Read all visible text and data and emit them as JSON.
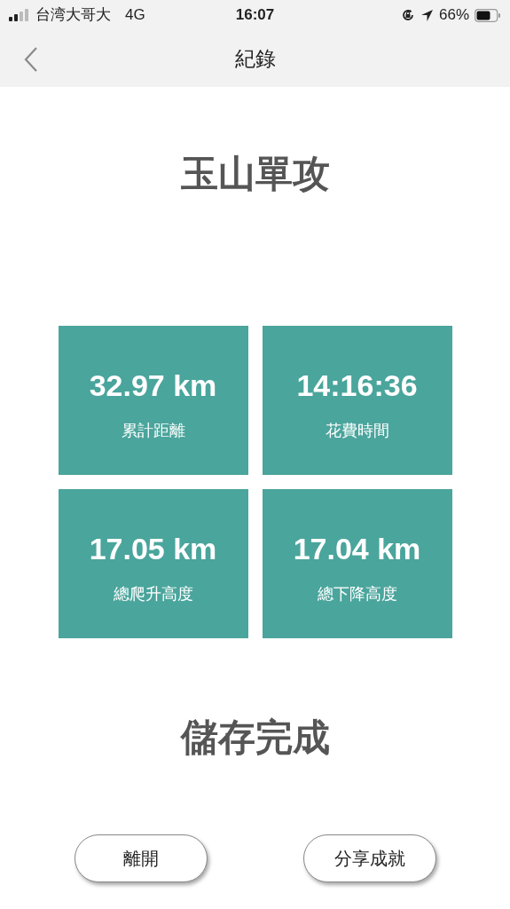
{
  "status_bar": {
    "carrier": "台湾大哥大",
    "network": "4G",
    "time": "16:07",
    "battery": "66%"
  },
  "nav": {
    "title": "紀錄"
  },
  "heading": "玉山單攻",
  "stats": [
    {
      "value": "32.97 km",
      "label": "累計距離"
    },
    {
      "value": "14:16:36",
      "label": "花費時間"
    },
    {
      "value": "17.05 km",
      "label": "總爬升高度"
    },
    {
      "value": "17.04 km",
      "label": "總下降高度"
    }
  ],
  "message": "儲存完成",
  "buttons": [
    "離開",
    "分享成就"
  ]
}
